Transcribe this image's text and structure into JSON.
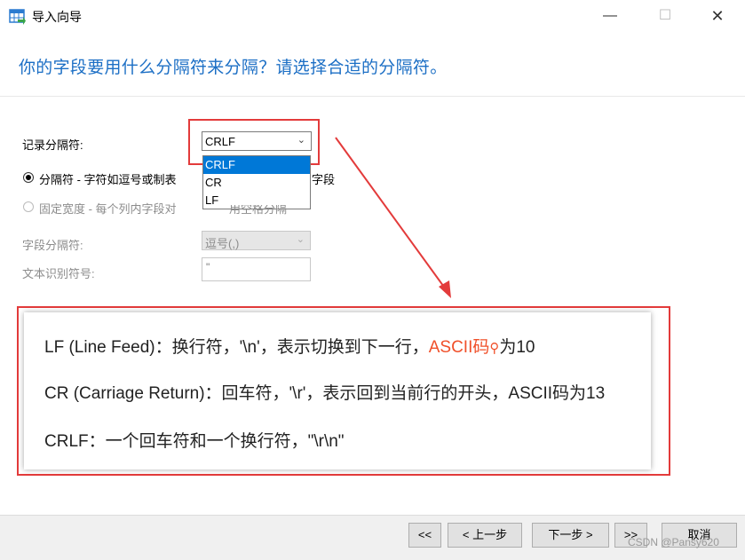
{
  "window": {
    "title": "导入向导",
    "icon": "table-import-icon",
    "controls": {
      "minimize": "—",
      "maximize": "☐",
      "close": "✕"
    }
  },
  "header": {
    "question": "你的字段要用什么分隔符来分隔？请选择合适的分隔符。"
  },
  "record_separator": {
    "label": "记录分隔符:",
    "value": "CRLF",
    "options": [
      "CRLF",
      "CR",
      "LF"
    ]
  },
  "mode": {
    "delimited_label": "分隔符 - 字符如逗号或制表",
    "delimited_tail": "字段",
    "fixed_label": "固定宽度 - 每个列内字段对",
    "fixed_tail": "用空格分隔"
  },
  "field_separator": {
    "label": "字段分隔符:",
    "value": "逗号(,)"
  },
  "text_qualifier": {
    "label": "文本识别符号:",
    "value": "\""
  },
  "info": {
    "line1_prefix": "LF (Line Feed)：换行符，'\\n'，表示切换到下一行，",
    "line1_highlight": "ASCII码",
    "line1_suffix": "为10",
    "line2": "CR (Carriage Return)：回车符，'\\r'，表示回到当前行的开头，ASCII码为13",
    "line3": "CRLF：一个回车符和一个换行符，\"\\r\\n\""
  },
  "footer": {
    "first": "<<",
    "prev": "< 上一步",
    "next": "下一步 >",
    "last": ">>",
    "cancel": "取消"
  },
  "watermark": "CSDN @Pansy620",
  "colors": {
    "accent": "#1c6fc5",
    "highlight_red": "#e33b3b",
    "selection_blue": "#0078d7",
    "link_orange": "#f0502a"
  }
}
